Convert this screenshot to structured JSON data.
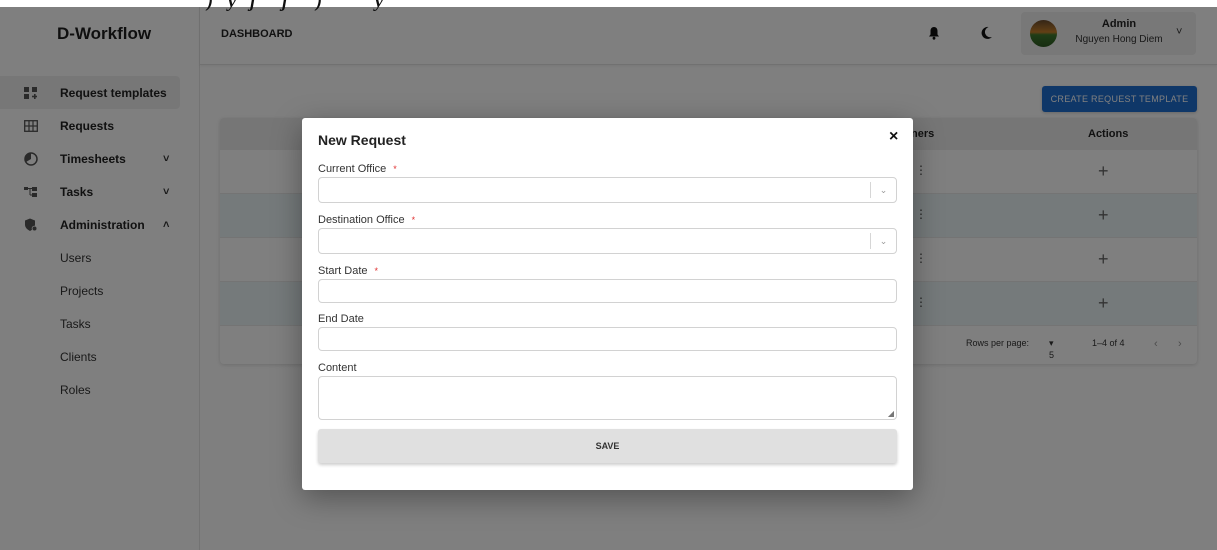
{
  "app": {
    "brand": "D-Workflow"
  },
  "sidebar": {
    "items": [
      {
        "label": "Request templates",
        "icon": "apps-add-icon",
        "active": true
      },
      {
        "label": "Requests",
        "icon": "table-grid-icon"
      },
      {
        "label": "Timesheets",
        "icon": "pie-chart-icon",
        "chevron": "˅"
      },
      {
        "label": "Tasks",
        "icon": "task-tree-icon",
        "chevron": "˅"
      },
      {
        "label": "Administration",
        "icon": "admin-shield-icon",
        "chevron": "˄"
      }
    ],
    "subitems": [
      "Users",
      "Projects",
      "Tasks",
      "Clients",
      "Roles"
    ]
  },
  "header": {
    "breadcrumb": "DASHBOARD",
    "user_role": "Admin",
    "user_name": "Nguyen Hong Diem"
  },
  "main": {
    "create_button": "CREATE REQUEST TEMPLATE",
    "columns": {
      "owners_partial": "ners",
      "actions": "Actions"
    },
    "row_count": 4,
    "footer": {
      "rows_per_page_label": "Rows per page:",
      "rows_per_page_value": "5",
      "range": "1–4 of 4"
    }
  },
  "modal": {
    "title": "New Request",
    "close": "×",
    "fields": {
      "current_office": "Current Office",
      "destination_office": "Destination Office",
      "start_date": "Start Date",
      "end_date": "End Date",
      "content": "Content"
    },
    "required_mark": "*",
    "save": "SAVE"
  },
  "colors": {
    "primary": "#1f6fd1",
    "row_alt": "#eaf5f6",
    "required": "#e03030",
    "overlay": "rgba(0,0,0,0.5)"
  }
}
